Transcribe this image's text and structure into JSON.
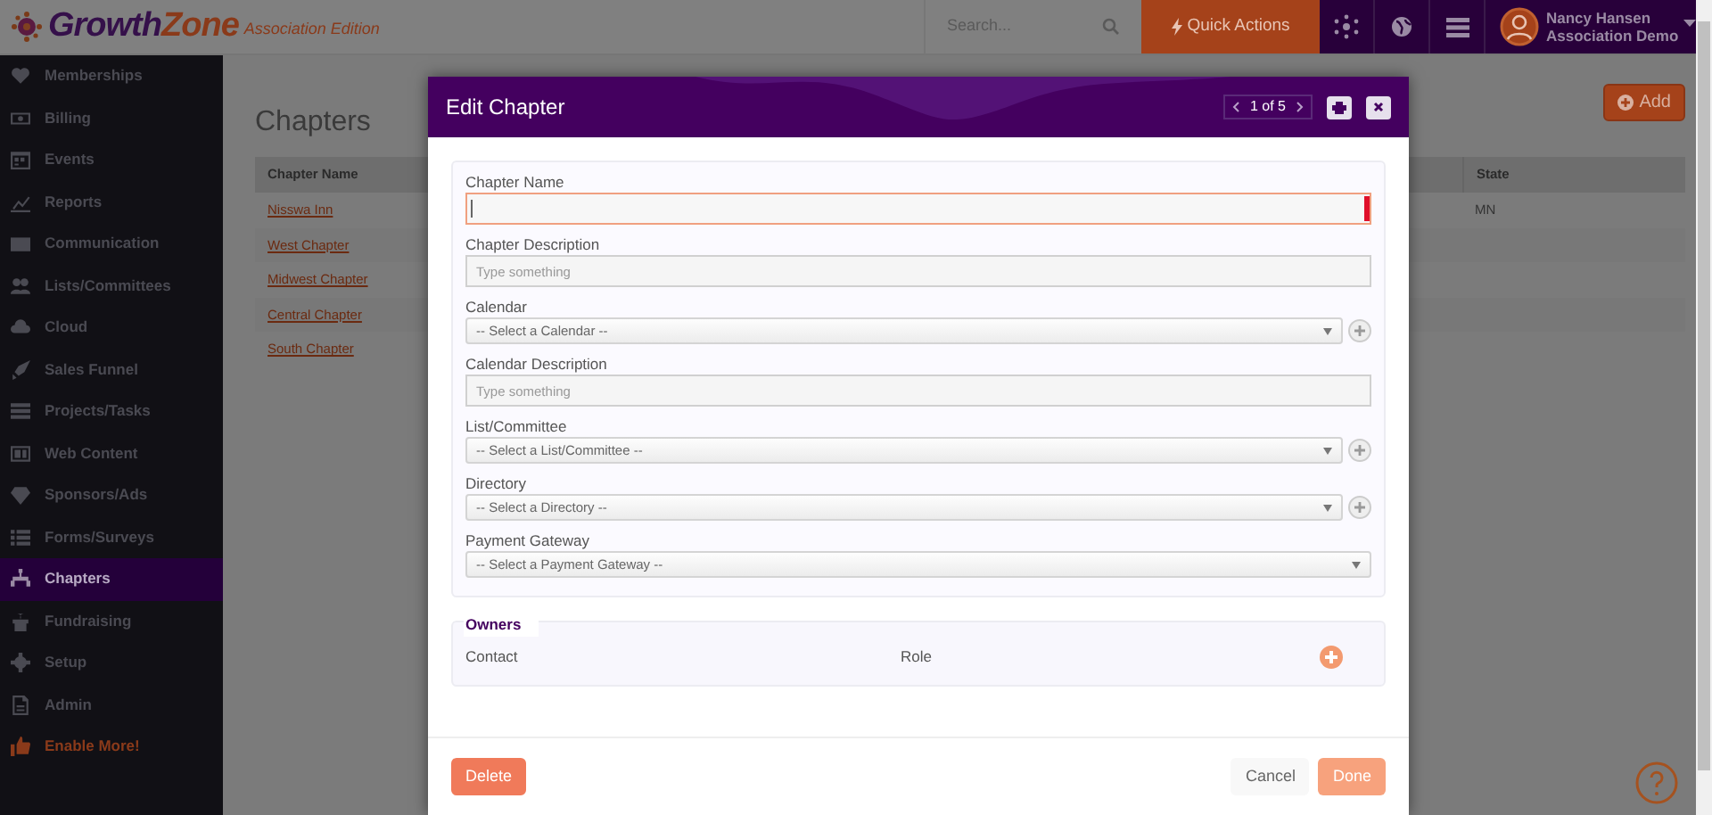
{
  "header": {
    "logo": [
      "Growth",
      "Zone"
    ],
    "edition": "Association Edition",
    "search": {
      "placeholder": "Search..."
    },
    "quick_actions": "Quick Actions",
    "user": {
      "name": "Nancy Hansen",
      "org": "Association Demo"
    }
  },
  "sidebar": {
    "items": [
      {
        "label": "Memberships",
        "selected": false,
        "kind": "nav"
      },
      {
        "label": "Billing",
        "selected": false,
        "kind": "nav"
      },
      {
        "label": "Events",
        "selected": false,
        "kind": "nav"
      },
      {
        "label": "Reports",
        "selected": false,
        "kind": "nav"
      },
      {
        "label": "Communication",
        "selected": false,
        "kind": "nav"
      },
      {
        "label": "Lists/Committees",
        "selected": false,
        "kind": "nav"
      },
      {
        "label": "Cloud",
        "selected": false,
        "kind": "nav"
      },
      {
        "label": "Sales Funnel",
        "selected": false,
        "kind": "nav"
      },
      {
        "label": "Projects/Tasks",
        "selected": false,
        "kind": "nav"
      },
      {
        "label": "Web Content",
        "selected": false,
        "kind": "nav"
      },
      {
        "label": "Sponsors/Ads",
        "selected": false,
        "kind": "nav"
      },
      {
        "label": "Forms/Surveys",
        "selected": false,
        "kind": "nav"
      },
      {
        "label": "Chapters",
        "selected": true,
        "kind": "nav"
      },
      {
        "label": "Fundraising",
        "selected": false,
        "kind": "nav"
      },
      {
        "label": "Setup",
        "selected": false,
        "kind": "nav"
      },
      {
        "label": "Admin",
        "selected": false,
        "kind": "nav"
      },
      {
        "label": "Enable More!",
        "selected": false,
        "kind": "promo"
      }
    ]
  },
  "page": {
    "title": "Chapters",
    "add_button": "Add",
    "table": {
      "columns": [
        "Chapter Name",
        "State"
      ],
      "rows": [
        {
          "name": "Nisswa Inn",
          "state": "MN"
        },
        {
          "name": "West Chapter"
        },
        {
          "name": "Midwest Chapter"
        },
        {
          "name": "Central Chapter"
        },
        {
          "name": "South Chapter"
        }
      ]
    }
  },
  "dialog": {
    "title": "Edit Chapter",
    "pager": "1 of 5",
    "fields": [
      {
        "label": "Chapter Name",
        "kind": "text",
        "focused": true
      },
      {
        "label": "Chapter Description",
        "kind": "text",
        "placeholder": "Type something",
        "focused": false
      },
      {
        "label": "Calendar",
        "kind": "select",
        "value": "-- Select a Calendar --",
        "addable": true
      },
      {
        "label": "Calendar Description",
        "kind": "text",
        "placeholder": "Type something",
        "focused": false
      },
      {
        "label": "List/Committee",
        "kind": "select",
        "value": "-- Select a List/Committee --",
        "addable": true
      },
      {
        "label": "Directory",
        "kind": "select",
        "value": "-- Select a Directory --",
        "addable": true
      },
      {
        "label": "Payment Gateway",
        "kind": "select",
        "value": "-- Select a Payment Gateway --",
        "addable": false
      }
    ],
    "owners": {
      "title": "Owners",
      "columns": [
        "Contact",
        "Role"
      ]
    },
    "buttons": {
      "delete": "Delete",
      "cancel": "Cancel",
      "done": "Done"
    }
  }
}
